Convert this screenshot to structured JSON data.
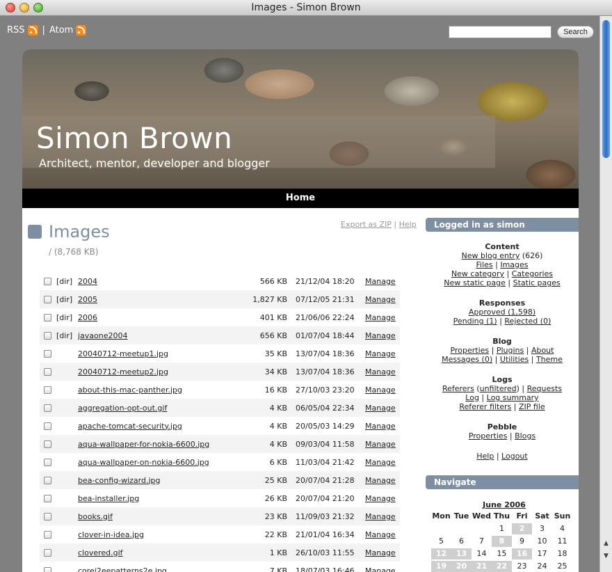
{
  "window": {
    "title": "Images - Simon Brown"
  },
  "feeds": {
    "rss": "RSS",
    "sep": "|",
    "atom": "Atom"
  },
  "search": {
    "button": "Search",
    "value": ""
  },
  "header": {
    "title": "Simon Brown",
    "subtitle": "Architect, mentor, developer and blogger"
  },
  "nav": {
    "home": "Home"
  },
  "main": {
    "title": "Images",
    "path": "/ (8,768 KB)",
    "export": "Export as ZIP",
    "sep": "|",
    "help": "Help",
    "manage_label": "Manage",
    "rows": [
      {
        "dir": "[dir]",
        "name": "2004",
        "size": "566 KB",
        "date": "21/12/04 18:20"
      },
      {
        "dir": "[dir]",
        "name": "2005",
        "size": "1,827 KB",
        "date": "07/12/05 21:31"
      },
      {
        "dir": "[dir]",
        "name": "2006",
        "size": "401 KB",
        "date": "21/06/06 22:24"
      },
      {
        "dir": "[dir]",
        "name": "javaone2004",
        "size": "656 KB",
        "date": "01/07/04 18:44"
      },
      {
        "dir": "",
        "name": "20040712-meetup1.jpg",
        "size": "35 KB",
        "date": "13/07/04 18:36"
      },
      {
        "dir": "",
        "name": "20040712-meetup2.jpg",
        "size": "34 KB",
        "date": "13/07/04 18:36"
      },
      {
        "dir": "",
        "name": "about-this-mac-panther.jpg",
        "size": "16 KB",
        "date": "27/10/03 23:20"
      },
      {
        "dir": "",
        "name": "aggregation-opt-out.gif",
        "size": "4 KB",
        "date": "06/05/04 22:34"
      },
      {
        "dir": "",
        "name": "apache-tomcat-security.jpg",
        "size": "4 KB",
        "date": "20/05/03 14:29"
      },
      {
        "dir": "",
        "name": "aqua-wallpaper-for-nokia-6600.jpg",
        "size": "4 KB",
        "date": "09/03/04 11:58"
      },
      {
        "dir": "",
        "name": "aqua-wallpaper-on-nokia-6600.jpg",
        "size": "6 KB",
        "date": "11/03/04 21:42"
      },
      {
        "dir": "",
        "name": "bea-config-wizard.jpg",
        "size": "25 KB",
        "date": "20/07/04 21:28"
      },
      {
        "dir": "",
        "name": "bea-installer.jpg",
        "size": "26 KB",
        "date": "20/07/04 21:20"
      },
      {
        "dir": "",
        "name": "books.gif",
        "size": "23 KB",
        "date": "11/09/03 21:32"
      },
      {
        "dir": "",
        "name": "clover-in-idea.jpg",
        "size": "22 KB",
        "date": "21/01/04 16:34"
      },
      {
        "dir": "",
        "name": "clovered.gif",
        "size": "1 KB",
        "date": "26/10/03 11:55"
      },
      {
        "dir": "",
        "name": "corej2eepatterns2e.jpg",
        "size": "7 KB",
        "date": "18/07/03 16:46"
      }
    ]
  },
  "sidebar": {
    "logged_in": "Logged in as simon",
    "content": {
      "heading": "Content",
      "new_entry": "New blog entry",
      "entry_count": "(626)",
      "files": "Files",
      "images": "Images",
      "new_category": "New category",
      "categories": "Categories",
      "new_static": "New static page",
      "static_pages": "Static pages"
    },
    "responses": {
      "heading": "Responses",
      "approved": "Approved (1,598)",
      "pending": "Pending (1)",
      "rejected": "Rejected (0)"
    },
    "blog": {
      "heading": "Blog",
      "properties": "Properties",
      "plugins": "Plugins",
      "about": "About",
      "messages": "Messages (0)",
      "utilities": "Utilities",
      "theme": "Theme"
    },
    "logs": {
      "heading": "Logs",
      "referers": "Referers",
      "unfiltered": "unfiltered",
      "requests": "Requests",
      "log": "Log",
      "log_summary": "Log summary",
      "referer_filters": "Referer filters",
      "zip_file": "ZIP file"
    },
    "pebble": {
      "heading": "Pebble",
      "properties": "Properties",
      "blogs": "Blogs"
    },
    "help": "Help",
    "logout": "Logout",
    "navigate": "Navigate",
    "calendar": {
      "month": "June 2006",
      "days": [
        "Mon",
        "Tue",
        "Wed",
        "Thu",
        "Fri",
        "Sat",
        "Sun"
      ],
      "cells": [
        "",
        "",
        "",
        "1",
        "2",
        "3",
        "4",
        "5",
        "6",
        "7",
        "8",
        "9",
        "10",
        "11",
        "12",
        "13",
        "14",
        "15",
        "16",
        "17",
        "18",
        "19",
        "20",
        "21",
        "22",
        "23",
        "24",
        "25"
      ],
      "highlighted": [
        "2",
        "8",
        "12",
        "13",
        "16",
        "19",
        "20",
        "21",
        "22"
      ]
    }
  }
}
